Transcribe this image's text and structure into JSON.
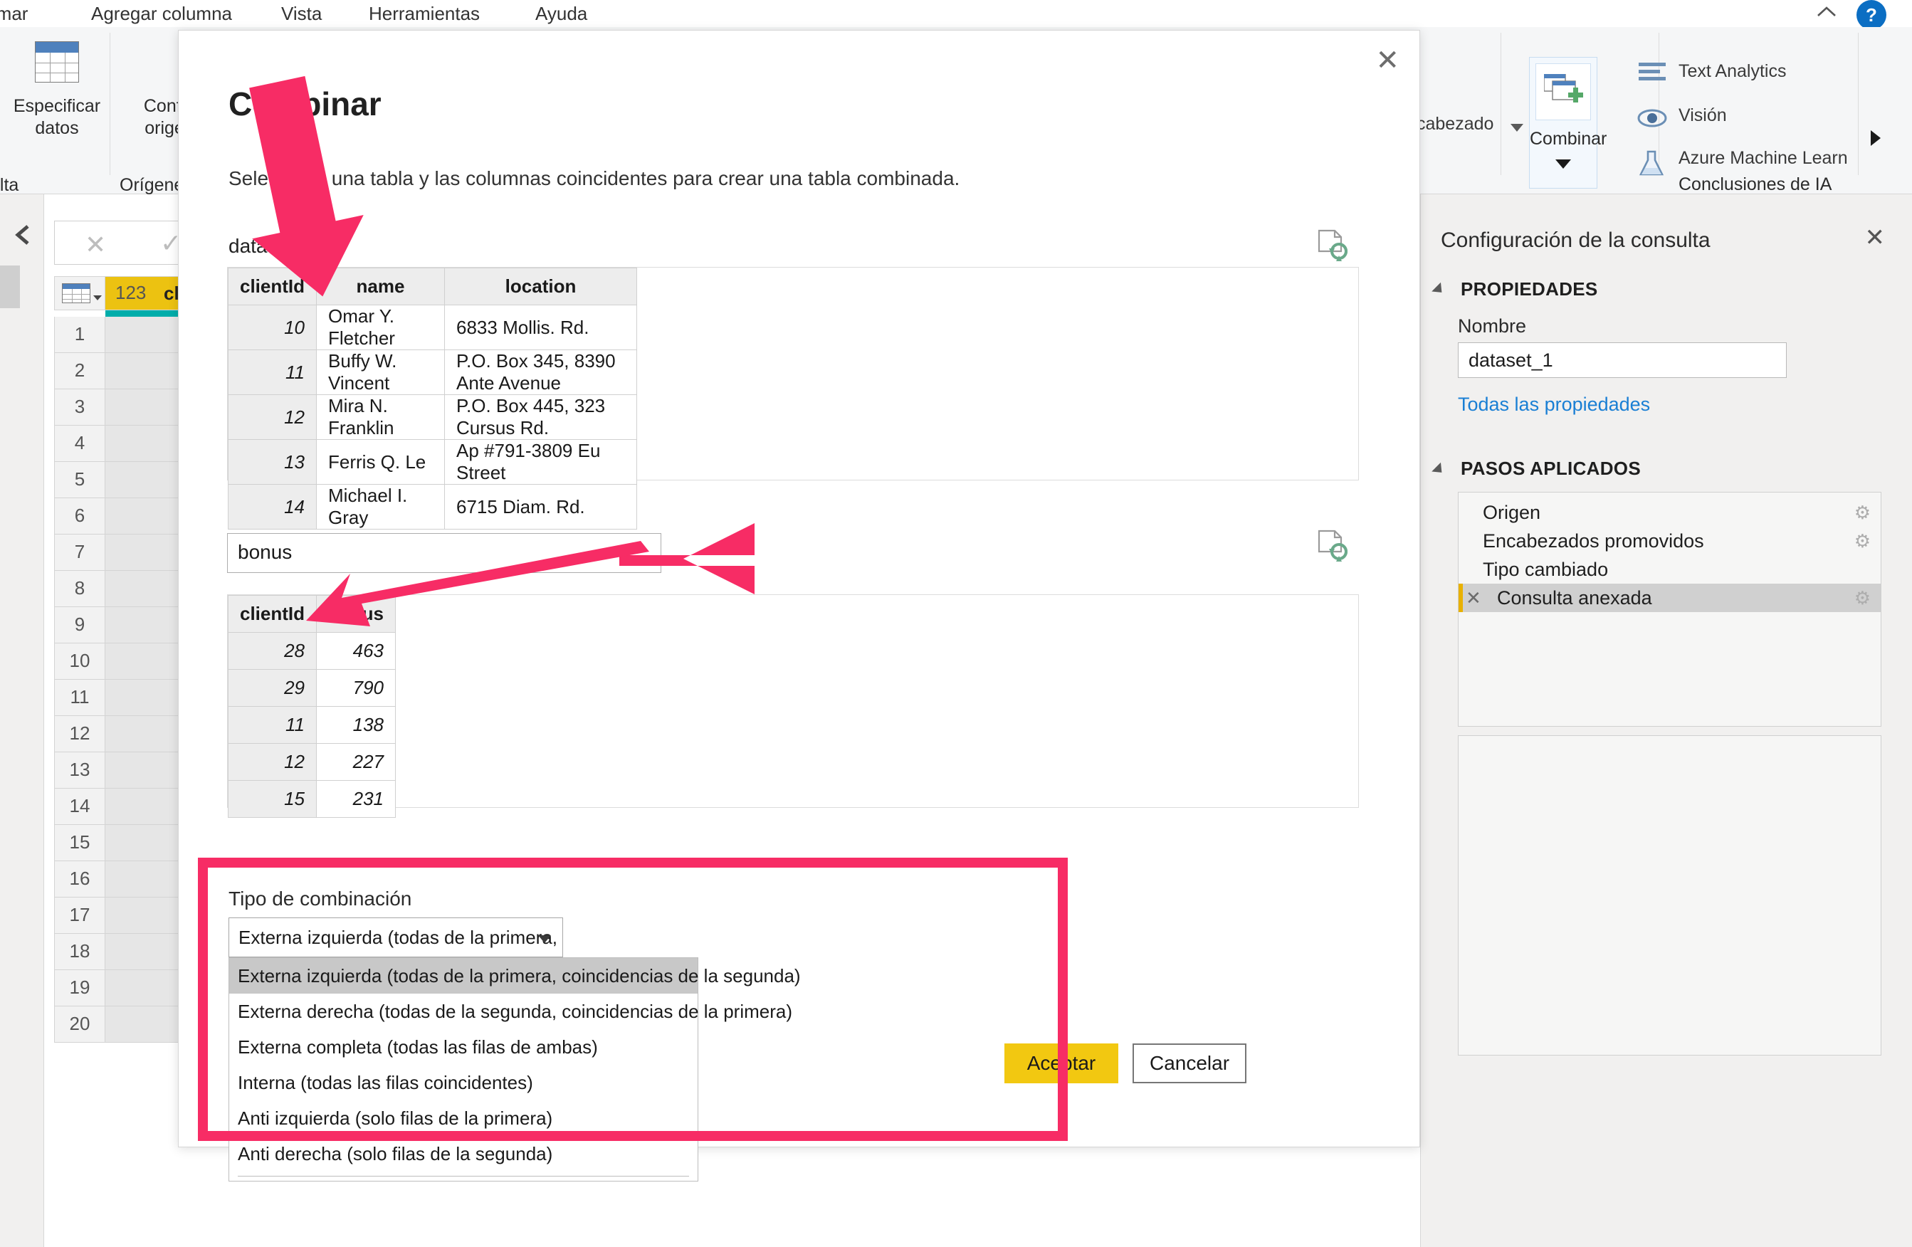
{
  "ribbon": {
    "tabs": [
      "rmar",
      "Agregar columna",
      "Vista",
      "Herramientas",
      "Ayuda"
    ],
    "collapse_icon": "chevron-up-icon",
    "help_label": "?",
    "buttons": [
      {
        "label_line1": "Especificar",
        "label_line2": "datos",
        "icon": "table-icon"
      },
      {
        "label_line1": "Config",
        "label_line2": "origen",
        "icon": "settings-icon"
      }
    ],
    "group_labels": [
      "ulta",
      "Orígenes"
    ],
    "header_dropdown_label": "cabezado",
    "combine_label": "Combinar",
    "ai_group_label": "Conclusiones de IA",
    "ai_items": [
      {
        "label": "Text Analytics",
        "icon": "text-analytics-icon"
      },
      {
        "label": "Visión",
        "icon": "eye-icon"
      },
      {
        "label": "Azure Machine Learn",
        "icon": "flask-icon"
      }
    ],
    "more_arrow": "chevron-right-icon"
  },
  "formula_bar": {
    "cancel_icon": "x-icon",
    "accept_icon": "check-icon"
  },
  "grid": {
    "column_type_badge": "123",
    "column_name": "clie",
    "row_numbers": [
      "1",
      "2",
      "3",
      "4",
      "5",
      "6",
      "7",
      "8",
      "9",
      "10",
      "11",
      "12",
      "13",
      "14",
      "15",
      "16",
      "17",
      "18",
      "19",
      "20"
    ]
  },
  "query_settings": {
    "title": "Configuración de la consulta",
    "close_icon": "close-icon",
    "properties_header": "PROPIEDADES",
    "name_label": "Nombre",
    "name_value": "dataset_1",
    "all_properties_link": "Todas las propiedades",
    "steps_header": "PASOS APLICADOS",
    "steps": [
      {
        "label": "Origen",
        "has_gear": true,
        "selected": false,
        "has_x": false
      },
      {
        "label": "Encabezados promovidos",
        "has_gear": true,
        "selected": false,
        "has_x": false
      },
      {
        "label": "Tipo cambiado",
        "has_gear": false,
        "selected": false,
        "has_x": false
      },
      {
        "label": "Consulta anexada",
        "has_gear": true,
        "selected": true,
        "has_x": true
      }
    ]
  },
  "dialog": {
    "title": "Combinar",
    "close_icon": "close-icon",
    "subtitle": "Seleccione una tabla y las columnas coincidentes para crear una tabla combinada.",
    "first_table_name": "dataset_1",
    "first_refresh_icon": "page-refresh-icon",
    "first_table": {
      "headers": [
        "clientId",
        "name",
        "location"
      ],
      "rows": [
        [
          "10",
          "Omar Y. Fletcher",
          "6833 Mollis. Rd."
        ],
        [
          "11",
          "Buffy W. Vincent",
          "P.O. Box 345, 8390 Ante Avenue"
        ],
        [
          "12",
          "Mira N. Franklin",
          "P.O. Box 445, 323 Cursus Rd."
        ],
        [
          "13",
          "Ferris Q. Le",
          "Ap #791-3809 Eu Street"
        ],
        [
          "14",
          "Michael I. Gray",
          "6715 Diam. Rd."
        ]
      ]
    },
    "second_table_input_value": "bonus",
    "second_refresh_icon": "page-refresh-icon",
    "second_table": {
      "headers": [
        "clientId",
        "bonus"
      ],
      "rows": [
        [
          "28",
          "463"
        ],
        [
          "29",
          "790"
        ],
        [
          "11",
          "138"
        ],
        [
          "12",
          "227"
        ],
        [
          "15",
          "231"
        ]
      ]
    },
    "merge_type_label": "Tipo de combinación",
    "merge_type_selected_display": "Externa izquierda (todas de la primera, coincidencias...",
    "merge_type_options": [
      "Externa izquierda (todas de la primera, coincidencias de la segunda)",
      "Externa derecha (todas de la segunda, coincidencias de la primera)",
      "Externa completa (todas las filas de ambas)",
      "Interna (todas las filas coincidentes)",
      "Anti izquierda (solo filas de la primera)",
      "Anti derecha (solo filas de la segunda)"
    ],
    "merge_type_selected_index": 0,
    "ok_label": "Aceptar",
    "cancel_label": "Cancelar"
  },
  "annotations": {
    "highlight_color": "#f72c65",
    "arrow_count": 3,
    "highlight_box_target": "merge-type-dropdown"
  },
  "colors": {
    "accent_yellow": "#f2c811",
    "link_blue": "#1a7fd4",
    "annotation_pink": "#f72c65",
    "column_header_yellow": "#ecc211",
    "column_underline_teal": "#00adaa"
  }
}
